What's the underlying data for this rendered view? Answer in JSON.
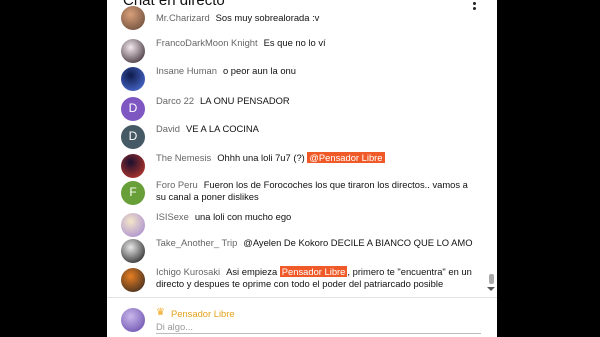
{
  "header": {
    "title": "Chat en directo",
    "menu_icon": "kebab-menu-icon"
  },
  "messages": [
    {
      "author": "Mr.Charizard",
      "avatar": {
        "type": "image",
        "colors": [
          "#d9a07a",
          "#6a4b3a"
        ]
      },
      "parts": [
        {
          "text": "Sos muy sobrealorada :v"
        }
      ]
    },
    {
      "author": "FrancoDarkMoon Knight",
      "avatar": {
        "type": "image",
        "colors": [
          "#f3e9ee",
          "#3b2a33"
        ]
      },
      "parts": [
        {
          "text": "Es que no lo ví"
        }
      ]
    },
    {
      "author": "Insane Human",
      "avatar": {
        "type": "image",
        "colors": [
          "#0f1b4a",
          "#4c6ed6"
        ]
      },
      "parts": [
        {
          "text": "o peor aun la onu"
        }
      ]
    },
    {
      "author": "Darco 22",
      "avatar": {
        "type": "letter",
        "letter": "D",
        "color": "#7e57c2"
      },
      "parts": [
        {
          "text": "LA ONU PENSADOR"
        }
      ]
    },
    {
      "author": "David",
      "avatar": {
        "type": "letter",
        "letter": "D",
        "color": "#455a64"
      },
      "parts": [
        {
          "text": "VE A LA COCINA"
        }
      ]
    },
    {
      "author": "The Nemesis",
      "avatar": {
        "type": "image",
        "colors": [
          "#1a1030",
          "#c0392b"
        ]
      },
      "parts": [
        {
          "text": "Ohhh una loli 7u7 (?)"
        },
        {
          "text": "@Pensador Libre",
          "mention": true
        }
      ]
    },
    {
      "author": "Foro Peru",
      "avatar": {
        "type": "letter",
        "letter": "F",
        "color": "#689f38"
      },
      "parts": [
        {
          "text": "Fueron los de Forocoches los que tiraron los directos.. vamos a su canal a poner dislikes"
        }
      ]
    },
    {
      "author": "ISISexe",
      "avatar": {
        "type": "image",
        "colors": [
          "#f4e6c8",
          "#a78bd1"
        ]
      },
      "parts": [
        {
          "text": "una loli con mucho ego"
        }
      ]
    },
    {
      "author": "Take_Another_ Trip",
      "avatar": {
        "type": "image",
        "colors": [
          "#e8e8e8",
          "#222222"
        ]
      },
      "parts": [
        {
          "text": "@Ayelen De Kokoro DECILE A BIANCO QUE LO AMO"
        }
      ]
    },
    {
      "author": "Ichigo Kurosaki",
      "avatar": {
        "type": "image",
        "colors": [
          "#e67e22",
          "#3a2a20"
        ]
      },
      "parts": [
        {
          "text": "Asi empieza"
        },
        {
          "text": "Pensador Libre",
          "mention": true
        },
        {
          "text": ", primero te \"encuentra\" en un directo y despues te oprime con todo el poder del patriarcado posible"
        }
      ]
    }
  ],
  "composer": {
    "crown_icon": "crown-icon",
    "author": "Pensador Libre",
    "placeholder": "Di algo...",
    "avatar_colors": [
      "#c9b8ea",
      "#6b4fb0"
    ]
  }
}
